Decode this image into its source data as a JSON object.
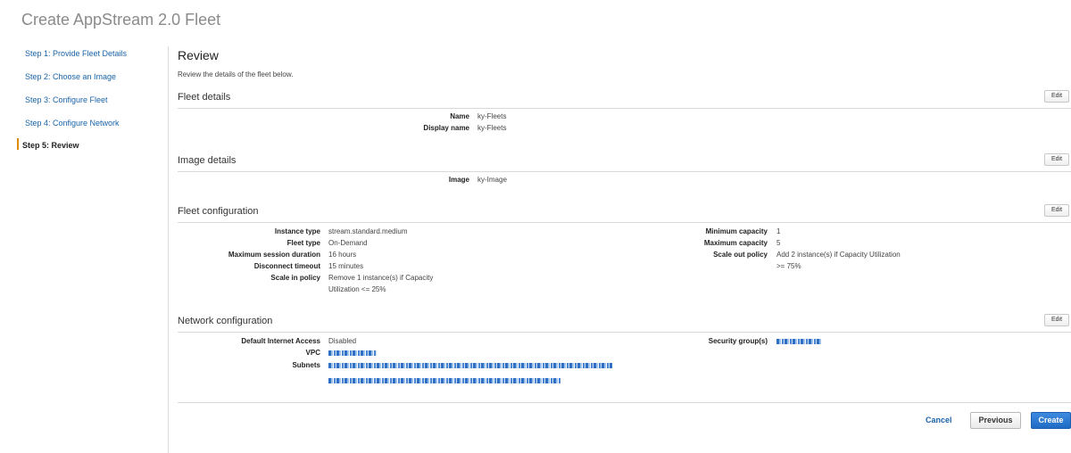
{
  "page": {
    "title": "Create AppStream 2.0 Fleet"
  },
  "steps": [
    {
      "label": "Step 1: Provide Fleet Details",
      "active": false
    },
    {
      "label": "Step 2: Choose an Image",
      "active": false
    },
    {
      "label": "Step 3: Configure Fleet",
      "active": false
    },
    {
      "label": "Step 4: Configure Network",
      "active": false
    },
    {
      "label": "Step 5: Review",
      "active": true
    }
  ],
  "review": {
    "title": "Review",
    "description": "Review the details of the fleet below.",
    "edit_label": "Edit",
    "fleet_details": {
      "title": "Fleet details",
      "name_label": "Name",
      "name_value": "ky-Fleets",
      "display_name_label": "Display name",
      "display_name_value": "ky-Fleets"
    },
    "image_details": {
      "title": "Image details",
      "image_label": "Image",
      "image_value": "ky-Image"
    },
    "fleet_configuration": {
      "title": "Fleet configuration",
      "instance_type_label": "Instance type",
      "instance_type_value": "stream.standard.medium",
      "fleet_type_label": "Fleet type",
      "fleet_type_value": "On-Demand",
      "max_session_label": "Maximum session duration",
      "max_session_value": "16 hours",
      "disconnect_label": "Disconnect timeout",
      "disconnect_value": "15 minutes",
      "scale_in_label": "Scale in policy",
      "scale_in_value_1": "Remove 1 instance(s) if Capacity",
      "scale_in_value_2": "Utilization <= 25%",
      "min_capacity_label": "Minimum capacity",
      "min_capacity_value": "1",
      "max_capacity_label": "Maximum capacity",
      "max_capacity_value": "5",
      "scale_out_label": "Scale out policy",
      "scale_out_value_1": "Add 2 instance(s) if Capacity Utilization",
      "scale_out_value_2": ">= 75%"
    },
    "network_configuration": {
      "title": "Network configuration",
      "internet_access_label": "Default Internet Access",
      "internet_access_value": "Disabled",
      "vpc_label": "VPC",
      "subnets_label": "Subnets",
      "security_groups_label": "Security group(s)"
    }
  },
  "footer": {
    "cancel_label": "Cancel",
    "previous_label": "Previous",
    "create_label": "Create"
  },
  "colors": {
    "link": "#1a64a8",
    "accent": "#e08a00",
    "primary_button": "#1f6bc4"
  }
}
